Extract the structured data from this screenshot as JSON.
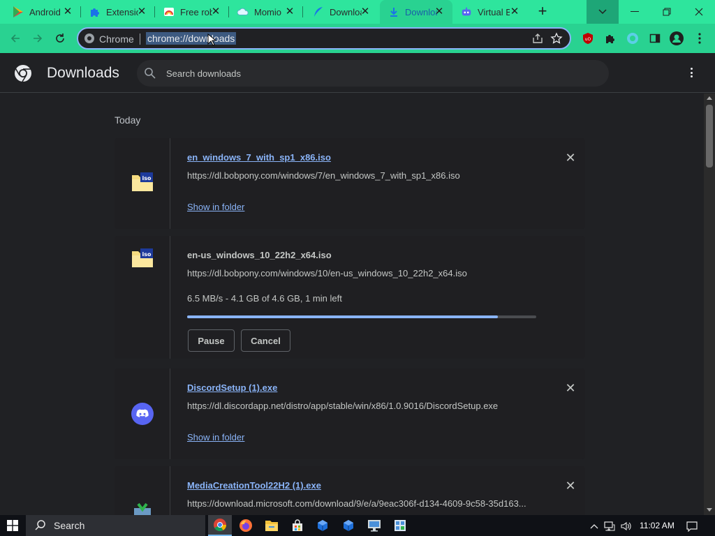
{
  "tabs": [
    {
      "label": "Android",
      "icon": "play-store-icon"
    },
    {
      "label": "Extensions",
      "icon": "puzzle-icon"
    },
    {
      "label": "Free robux",
      "icon": "rainbow-icon"
    },
    {
      "label": "Momio",
      "icon": "cloud-icon"
    },
    {
      "label": "Downloads",
      "icon": "feather-icon"
    },
    {
      "label": "Downloads",
      "icon": "download-icon",
      "active": true
    },
    {
      "label": "Virtual Box",
      "icon": "robot-icon"
    }
  ],
  "omnibox": {
    "site_label": "Chrome",
    "url": "chrome://downloads"
  },
  "page": {
    "title": "Downloads",
    "search_placeholder": "Search downloads",
    "date_label": "Today"
  },
  "downloads": [
    {
      "filename": "en_windows_7_with_sp1_x86.iso",
      "url": "https://dl.bobpony.com/windows/7/en_windows_7_with_sp1_x86.iso",
      "action": "Show in folder",
      "icon": "iso-file-icon"
    },
    {
      "filename": "en-us_windows_10_22h2_x64.iso",
      "url": "https://dl.bobpony.com/windows/10/en-us_windows_10_22h2_x64.iso",
      "status": "6.5 MB/s - 4.1 GB of 4.6 GB, 1 min left",
      "progress": 0.89,
      "pause_label": "Pause",
      "cancel_label": "Cancel",
      "icon": "iso-file-icon"
    },
    {
      "filename": "DiscordSetup (1).exe",
      "url": "https://dl.discordapp.net/distro/app/stable/win/x86/1.0.9016/DiscordSetup.exe",
      "action": "Show in folder",
      "icon": "discord-icon"
    },
    {
      "filename": "MediaCreationTool22H2 (1).exe",
      "url": "https://download.microsoft.com/download/9/e/a/9eac306f-d134-4609-9c58-35d163...",
      "icon": "media-tool-icon"
    }
  ],
  "taskbar": {
    "search_label": "Search",
    "time": "11:02 AM"
  },
  "colors": {
    "tabstrip": "#2ee59d",
    "toolbar": "#29d291",
    "link": "#8ab4f8",
    "background": "#202124"
  }
}
